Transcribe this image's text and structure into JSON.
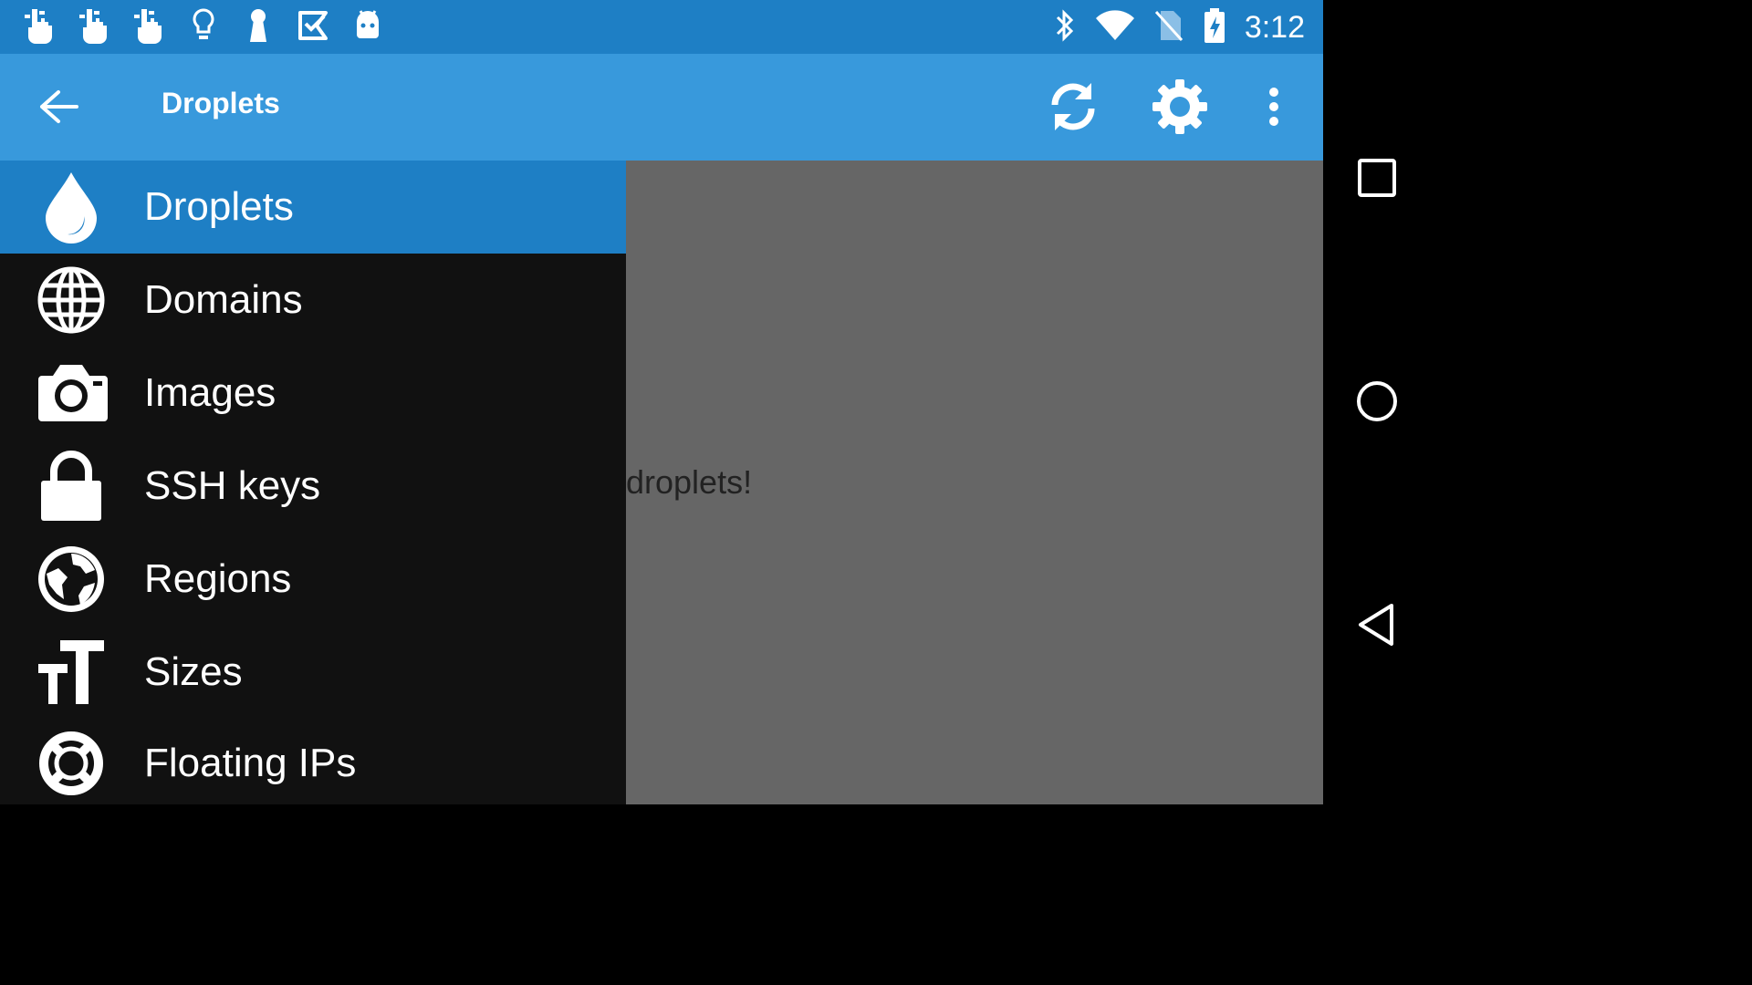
{
  "status_bar": {
    "notification_icons": [
      "hand-pointer-icon",
      "hand-pointer-icon",
      "hand-pointer-icon",
      "lightbulb-icon",
      "keyhole-icon",
      "check-tag-icon",
      "android-icon"
    ],
    "system_icons": [
      "bluetooth-icon",
      "wifi-icon",
      "no-sim-icon",
      "battery-charging-icon"
    ],
    "time": "3:12",
    "color": "#1e7fc5"
  },
  "app_bar": {
    "title": "Droplets",
    "actions": [
      "refresh-icon",
      "settings-icon",
      "overflow-menu-icon"
    ],
    "color": "#3899dc"
  },
  "content": {
    "text": "droplets!"
  },
  "drawer": {
    "items": [
      {
        "label": "Droplets",
        "icon": "droplet-icon",
        "active": true
      },
      {
        "label": "Domains",
        "icon": "globe-icon",
        "active": false
      },
      {
        "label": "Images",
        "icon": "camera-icon",
        "active": false
      },
      {
        "label": "SSH keys",
        "icon": "lock-icon",
        "active": false
      },
      {
        "label": "Regions",
        "icon": "earth-icon",
        "active": false
      },
      {
        "label": "Sizes",
        "icon": "text-size-icon",
        "active": false
      },
      {
        "label": "Floating IPs",
        "icon": "lifebuoy-icon",
        "active": false
      }
    ],
    "active_color": "#1e7fc5",
    "background": "#111111"
  },
  "nav_bar": {
    "buttons": [
      "recents-icon",
      "home-icon",
      "back-icon"
    ]
  }
}
